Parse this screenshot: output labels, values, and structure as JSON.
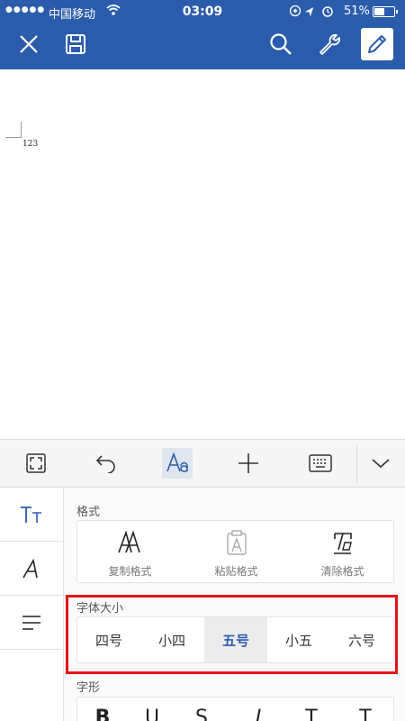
{
  "status_bar": {
    "signal_dots": "●●●●●",
    "carrier": "中国移动",
    "time": "03:09",
    "battery": "51%",
    "battery_level": 0.51
  },
  "toolbar": {
    "buttons": [
      "close-icon",
      "save-icon",
      "search-icon",
      "wrench-icon",
      "pencil-icon"
    ],
    "accent_color": "#2b5cac"
  },
  "document": {
    "text": "123"
  },
  "ribbon": {
    "buttons": [
      "fullscreen-icon",
      "undo-icon",
      "font-format-icon",
      "add-icon",
      "keyboard-icon",
      "chevron-down-icon"
    ],
    "selected": "font-format-icon"
  },
  "side_tabs": [
    "text-size-icon",
    "italic-font-icon",
    "paragraph-align-icon"
  ],
  "format_section": {
    "title": "格式",
    "items": [
      {
        "label": "复制格式",
        "icon": "copy-format-icon"
      },
      {
        "label": "粘贴格式",
        "icon": "paste-format-icon"
      },
      {
        "label": "清除格式",
        "icon": "clear-format-icon"
      }
    ]
  },
  "font_size_section": {
    "title": "字体大小",
    "options": [
      "四号",
      "小四",
      "五号",
      "小五",
      "六号"
    ],
    "selected": "五号",
    "highlight_color": "#e3141b"
  },
  "font_style_section": {
    "title": "字形",
    "options": [
      "B",
      "U",
      "S",
      "I",
      "T",
      "T"
    ]
  }
}
